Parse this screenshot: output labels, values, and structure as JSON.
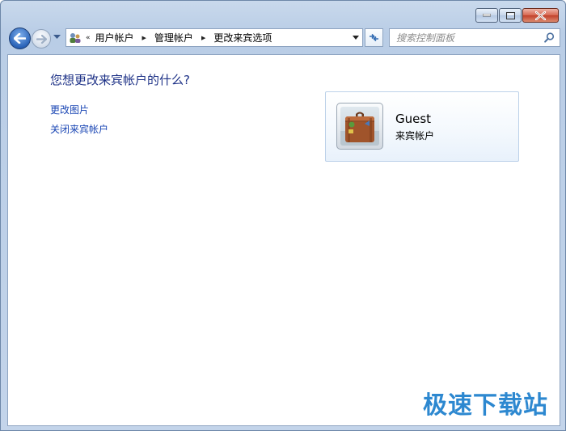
{
  "window": {
    "caption_buttons": [
      "minimize-icon",
      "maximize-icon",
      "close-icon"
    ]
  },
  "navigation": {
    "back_icon": "back-arrow-icon",
    "forward_icon": "forward-arrow-icon"
  },
  "address_bar": {
    "overflow": "«",
    "breadcrumbs": [
      "用户帐户",
      "管理帐户",
      "更改来宾选项"
    ]
  },
  "search": {
    "placeholder": "搜索控制面板"
  },
  "main": {
    "question": "您想更改来宾帐户的什么?",
    "tasks": [
      "更改图片",
      "关闭来宾帐户"
    ]
  },
  "account": {
    "name": "Guest",
    "type": "来宾帐户",
    "avatar_icon": "briefcase-icon"
  },
  "watermark": "极速下载站",
  "colors": {
    "link": "#1a46b4",
    "heading": "#1e3287",
    "watermark": "#2d88d0"
  }
}
